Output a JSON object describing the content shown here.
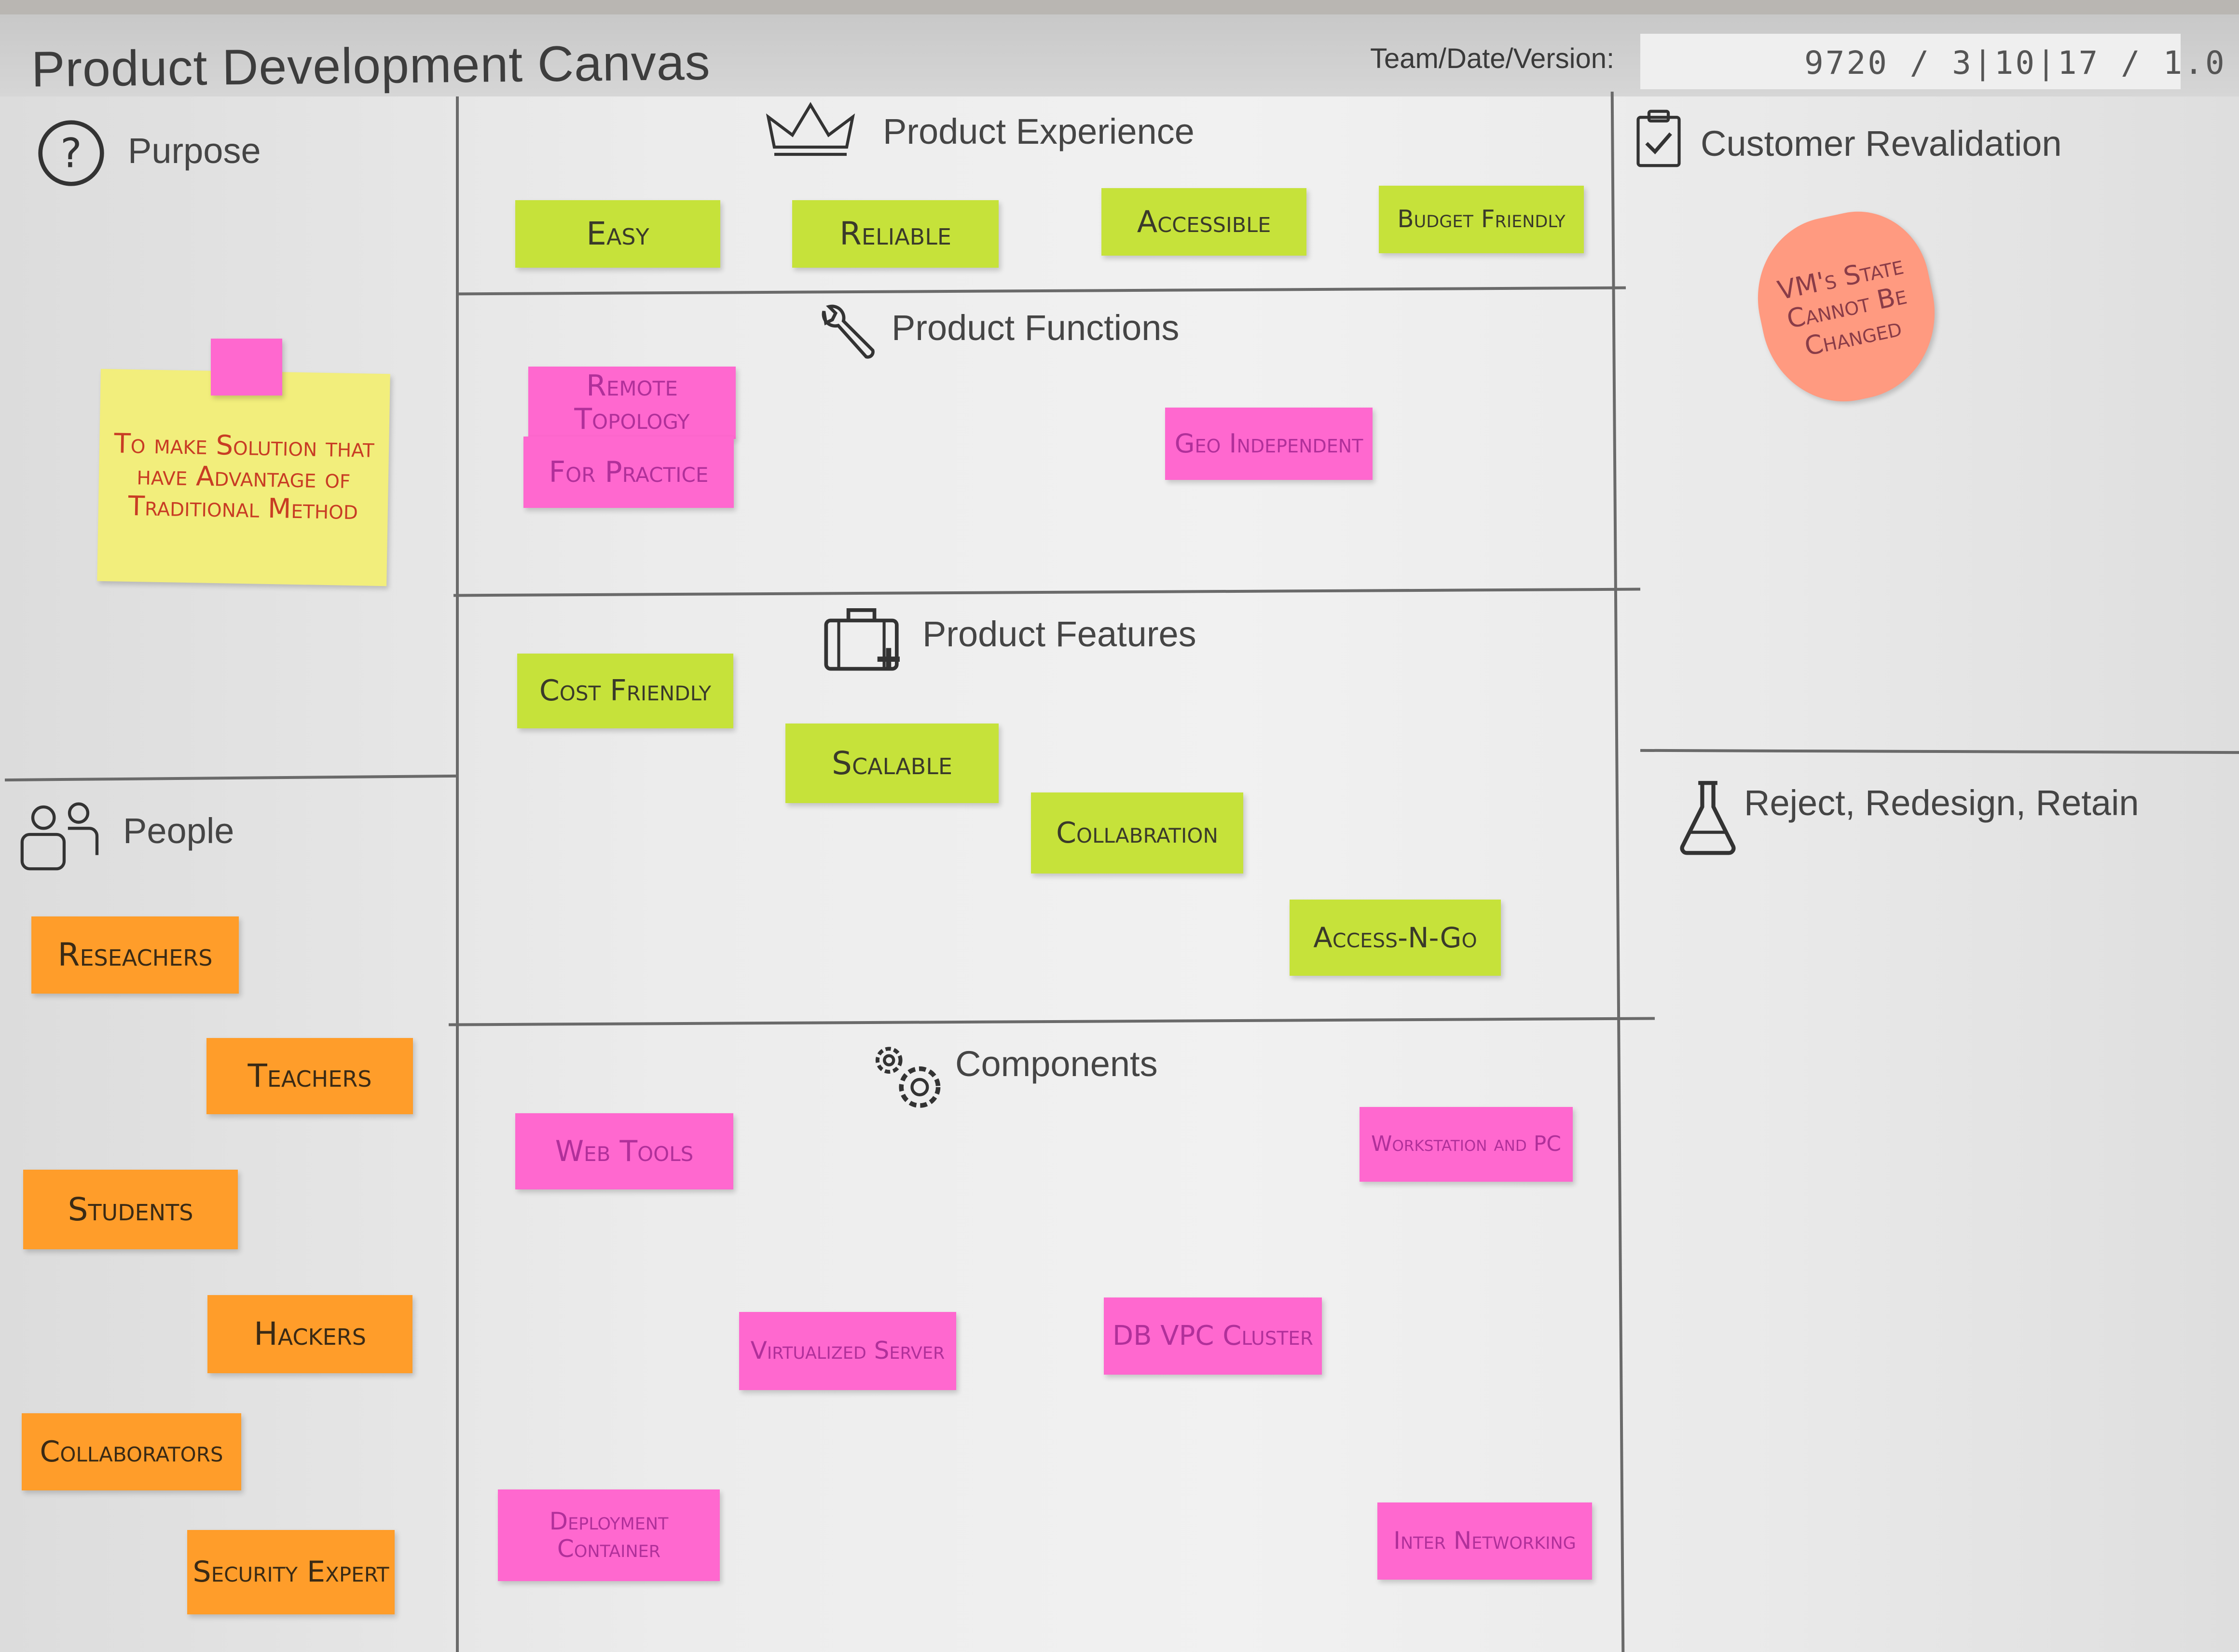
{
  "canvas": {
    "title": "Product Development Canvas",
    "team_date_version_label": "Team/Date/Version:",
    "team_date_version_value": "9720 / 3|10|17 / 1.0"
  },
  "sections": {
    "purpose": "Purpose",
    "people": "People",
    "product_experience": "Product Experience",
    "product_functions": "Product Functions",
    "product_features": "Product Features",
    "components": "Components",
    "customer_revalidation": "Customer Revalidation",
    "reject_redesign_retain": "Reject, Redesign, Retain"
  },
  "notes": {
    "purpose": [
      "To make Solution that have Advantage of Traditional Method"
    ],
    "people": [
      "Reseachers",
      "Teachers",
      "Students",
      "Hackers",
      "Collaborators",
      "Security Expert"
    ],
    "product_experience": [
      "Easy",
      "Reliable",
      "Accessible",
      "Budget Friendly"
    ],
    "product_functions": [
      "Remote Topology",
      "For Practice",
      "Geo Independent"
    ],
    "product_features": [
      "Cost Friendly",
      "Scalable",
      "Collabration",
      "Access-N-Go"
    ],
    "components": [
      "Web Tools",
      "Workstation and PC",
      "Virtualized Server",
      "DB VPC Cluster",
      "Deployment Container",
      "Inter Networking"
    ],
    "customer_revalidation": [
      "VM's State Cannot Be Changed"
    ]
  },
  "colors": {
    "green_note": "#c6e23a",
    "orange_note": "#ff9d2a",
    "pink_note": "#ff68cf",
    "yellow_note": "#f2ee7c",
    "salmon_note": "#ff9a80",
    "lines": "#6a6a6a"
  },
  "icons": {
    "purpose": "question-mark-icon",
    "people": "people-icon",
    "product_experience": "crown-icon",
    "product_functions": "wrench-icon",
    "product_features": "briefcase-plus-icon",
    "components": "gears-icon",
    "customer_revalidation": "clipboard-check-icon",
    "reject_redesign_retain": "flask-icon"
  }
}
